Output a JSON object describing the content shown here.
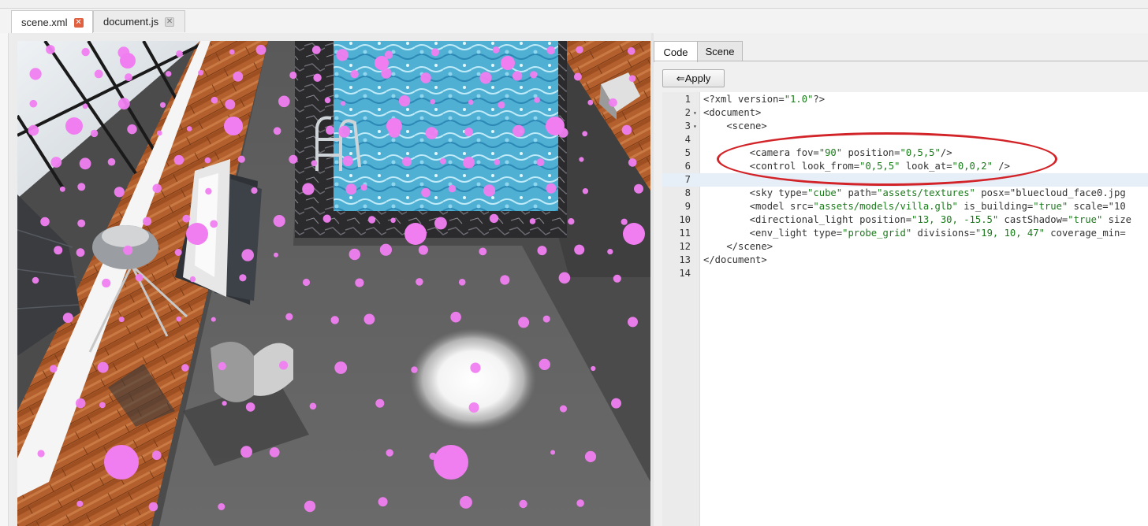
{
  "tabs": [
    {
      "label": "scene.xml",
      "active": true
    },
    {
      "label": "document.js",
      "active": false
    }
  ],
  "tab_close_glyph": "✕",
  "panel_tabs": [
    {
      "label": "Code",
      "active": true
    },
    {
      "label": "Scene",
      "active": false
    }
  ],
  "apply_button": {
    "icon": "⇐",
    "label": "Apply"
  },
  "editor": {
    "active_line": 7,
    "lines": [
      {
        "n": "1",
        "fold": "",
        "text": "<?xml version=\"1.0\"?>"
      },
      {
        "n": "2",
        "fold": "▾",
        "text": "<document>"
      },
      {
        "n": "3",
        "fold": "▾",
        "text": "    <scene>"
      },
      {
        "n": "4",
        "fold": "",
        "text": ""
      },
      {
        "n": "5",
        "fold": "",
        "text": "        <camera fov=\"90\" position=\"0,5,5\"/>"
      },
      {
        "n": "6",
        "fold": "",
        "text": "        <control look_from=\"0,5,5\" look_at=\"0,0,2\" />"
      },
      {
        "n": "7",
        "fold": "",
        "text": ""
      },
      {
        "n": "8",
        "fold": "",
        "text": "        <sky type=\"cube\" path=\"assets/textures\" posx=\"bluecloud_face0.jpg"
      },
      {
        "n": "9",
        "fold": "",
        "text": "        <model src=\"assets/models/villa.glb\" is_building=\"true\" scale=\"10"
      },
      {
        "n": "10",
        "fold": "",
        "text": "        <directional_light position=\"13, 30, -15.5\" castShadow=\"true\" size"
      },
      {
        "n": "11",
        "fold": "",
        "text": "        <env_light type=\"probe_grid\" divisions=\"19, 10, 47\" coverage_min="
      },
      {
        "n": "12",
        "fold": "",
        "text": "    </scene>"
      },
      {
        "n": "13",
        "fold": "",
        "text": "</document>"
      },
      {
        "n": "14",
        "fold": "",
        "text": ""
      }
    ]
  },
  "syntax_colors": {
    "tag": "#333333",
    "attr": "#333333",
    "value": "#1a7a1a",
    "line_number": "#333333"
  },
  "annotation": {
    "color": "#d22428",
    "shape": "ellipse",
    "encloses_lines": [
      5,
      6
    ]
  },
  "viewport": {
    "description_icon": "3d-scene-viewport",
    "probe_color": "#f07ef0",
    "floor_color": "#555555",
    "wood_color": "#b4602e",
    "water_color": "#5ab8d8"
  }
}
